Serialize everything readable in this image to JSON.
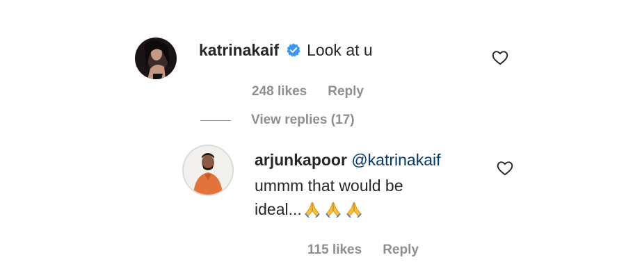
{
  "comment": {
    "username": "katrinakaif",
    "verified_icon": "verified-badge-icon",
    "text": "Look at u",
    "likes": "248 likes",
    "reply_label": "Reply",
    "view_replies": "View replies (17)",
    "like_icon": "heart-icon"
  },
  "reply": {
    "username": "arjunkapoor",
    "mention": "@katrinakaif",
    "text_line1": "ummm that would be",
    "text_line2": "ideal...",
    "emojis": [
      "folded-hands-emoji",
      "folded-hands-emoji",
      "folded-hands-emoji"
    ],
    "likes": "115 likes",
    "reply_label": "Reply",
    "like_icon": "heart-icon"
  },
  "colors": {
    "text_primary": "#262626",
    "text_secondary": "#8e8e8e",
    "mention": "#00376b",
    "verified_blue": "#3897f0"
  }
}
